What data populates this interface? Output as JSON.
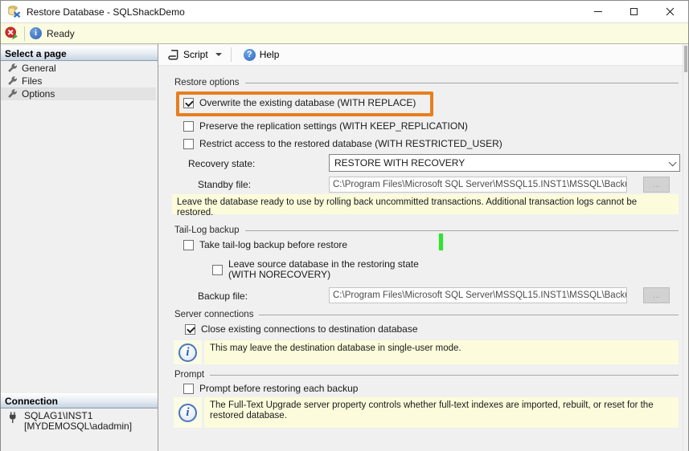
{
  "window": {
    "title": "Restore Database - SQLShackDemo"
  },
  "statusbar": {
    "status": "Ready"
  },
  "sidebar": {
    "pages_header": "Select a page",
    "items": [
      {
        "label": "General",
        "selected": false
      },
      {
        "label": "Files",
        "selected": false
      },
      {
        "label": "Options",
        "selected": true
      }
    ],
    "connection_header": "Connection",
    "connection": {
      "server": "SQLAG1\\INST1",
      "user": "[MYDEMOSQL\\adadmin]"
    }
  },
  "toolbar": {
    "script": "Script",
    "help": "Help"
  },
  "sections": {
    "restore_options": {
      "title": "Restore options",
      "overwrite": {
        "label": "Overwrite the existing database (WITH REPLACE)",
        "checked": true
      },
      "preserve": {
        "label": "Preserve the replication settings (WITH KEEP_REPLICATION)",
        "checked": false
      },
      "restrict": {
        "label": "Restrict access to the restored database (WITH RESTRICTED_USER)",
        "checked": false
      },
      "recovery_state_label": "Recovery state:",
      "recovery_state_value": "RESTORE WITH RECOVERY",
      "standby_file_label": "Standby file:",
      "standby_file_value": "C:\\Program Files\\Microsoft SQL Server\\MSSQL15.INST1\\MSSQL\\Backup\\",
      "browse_label": "...",
      "note": "Leave the database ready to use by rolling back uncommitted transactions. Additional transaction logs cannot be restored."
    },
    "tail_log": {
      "title": "Tail-Log backup",
      "take": {
        "label": "Take tail-log backup before restore",
        "checked": false
      },
      "leave": {
        "line1": "Leave source database in the restoring state",
        "line2": "(WITH NORECOVERY)",
        "checked": false
      },
      "backup_file_label": "Backup file:",
      "backup_file_value": "C:\\Program Files\\Microsoft SQL Server\\MSSQL15.INST1\\MSSQL\\Backup\\",
      "browse_label": "..."
    },
    "server_connections": {
      "title": "Server connections",
      "close_existing": {
        "label": "Close existing connections to destination database",
        "checked": true
      },
      "note": "This may leave the destination database in single-user mode."
    },
    "prompt": {
      "title": "Prompt",
      "prompt_each": {
        "label": "Prompt before restoring each backup",
        "checked": false
      },
      "note": "The Full-Text Upgrade server property controls whether full-text indexes are imported, rebuilt, or reset for the restored database."
    }
  },
  "colors": {
    "highlight_box": "#E87E1E",
    "caret": "#2FE32F",
    "note_bg": "#FCFCDC",
    "accent_blue": "#3B6EC5"
  }
}
